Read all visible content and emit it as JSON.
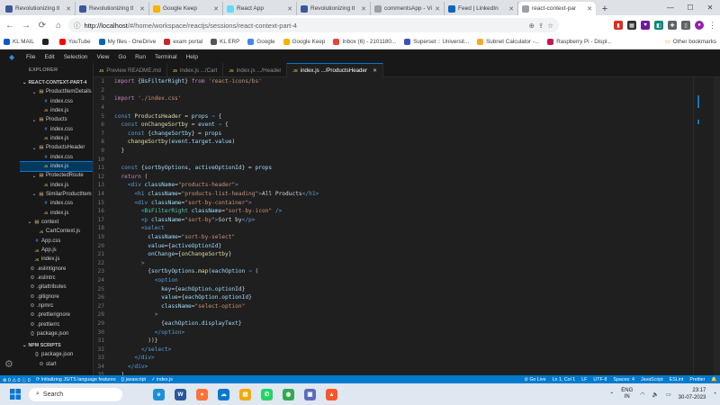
{
  "browser": {
    "tabs": [
      {
        "title": "Revolutionizing tl",
        "color": "#3b5998",
        "active": false
      },
      {
        "title": "Revolutionizing tl",
        "color": "#3b5998",
        "active": false
      },
      {
        "title": "Google Keep",
        "color": "#f4b400",
        "active": false
      },
      {
        "title": "React App",
        "color": "#61dafb",
        "active": false
      },
      {
        "title": "Revolutionizing tl",
        "color": "#3b5998",
        "active": false
      },
      {
        "title": "commentsApp - Vi",
        "color": "#9aa0a6",
        "active": false
      },
      {
        "title": "Feed | LinkedIn",
        "color": "#0a66c2",
        "active": false
      },
      {
        "title": "react-context-par",
        "color": "#9aa0a6",
        "active": true
      }
    ],
    "url_host": "http://localhost",
    "url_path": "/#/home/workspace/reactjs/sessions/react-context-part-4",
    "bookmarks": [
      {
        "label": "KL MAIL",
        "color": "#0b57d0"
      },
      {
        "label": "",
        "color": "#222222"
      },
      {
        "label": "YouTube",
        "color": "#ff0000"
      },
      {
        "label": "My files - OneDrive",
        "color": "#0364b8"
      },
      {
        "label": "exam portal",
        "color": "#c62828"
      },
      {
        "label": "KL ERP",
        "color": "#555555"
      },
      {
        "label": "Google",
        "color": "#4285f4"
      },
      {
        "label": "Google Keep",
        "color": "#f4b400"
      },
      {
        "label": "Inbox (6) - 2101180...",
        "color": "#ea4335"
      },
      {
        "label": "Superset :: Universit...",
        "color": "#3f51b5"
      },
      {
        "label": "Subnet Calculator -...",
        "color": "#f9a825"
      },
      {
        "label": "Raspberry Pi - Displ...",
        "color": "#c51a4a"
      }
    ],
    "other_bookmarks": "Other bookmarks"
  },
  "vscode": {
    "menu": [
      "File",
      "Edit",
      "Selection",
      "View",
      "Go",
      "Run",
      "Terminal",
      "Help"
    ],
    "explorer_title": "EXPLORER",
    "project_title": "REACT-CONTEXT-PART-4",
    "npm_scripts_title": "NPM SCRIPTS",
    "tree": [
      {
        "label": "ProductItemDetails",
        "type": "folder",
        "indent": 2,
        "open": true,
        "ghost": false
      },
      {
        "label": "index.css",
        "type": "css",
        "indent": 3
      },
      {
        "label": "index.js",
        "type": "js",
        "indent": 3
      },
      {
        "label": "Products",
        "type": "folder",
        "indent": 2,
        "open": true
      },
      {
        "label": "index.css",
        "type": "css",
        "indent": 3
      },
      {
        "label": "index.js",
        "type": "js",
        "indent": 3
      },
      {
        "label": "ProductsHeader",
        "type": "folder",
        "indent": 2,
        "open": true
      },
      {
        "label": "index.css",
        "type": "css",
        "indent": 3
      },
      {
        "label": "index.js",
        "type": "js",
        "indent": 3,
        "selected": true
      },
      {
        "label": "ProtectedRoute",
        "type": "folder",
        "indent": 2,
        "open": true
      },
      {
        "label": "index.js",
        "type": "js",
        "indent": 3
      },
      {
        "label": "SimilarProductItem",
        "type": "folder",
        "indent": 2,
        "open": true
      },
      {
        "label": "index.css",
        "type": "css",
        "indent": 3
      },
      {
        "label": "index.js",
        "type": "js",
        "indent": 3
      },
      {
        "label": "context",
        "type": "folder",
        "indent": 1,
        "open": true
      },
      {
        "label": "CartContext.js",
        "type": "js",
        "indent": 2
      },
      {
        "label": "App.css",
        "type": "css",
        "indent": 1
      },
      {
        "label": "App.js",
        "type": "js",
        "indent": 1
      },
      {
        "label": "index.js",
        "type": "js",
        "indent": 1
      },
      {
        "label": ".eslintignore",
        "type": "cfg",
        "indent": 0
      },
      {
        "label": ".eslintrc",
        "type": "cfg",
        "indent": 0
      },
      {
        "label": ".gitattributes",
        "type": "cfg",
        "indent": 0
      },
      {
        "label": ".gitignore",
        "type": "cfg",
        "indent": 0
      },
      {
        "label": ".npmrc",
        "type": "cfg",
        "indent": 0
      },
      {
        "label": ".prettierignore",
        "type": "cfg",
        "indent": 0
      },
      {
        "label": ".prettierrc",
        "type": "cfg",
        "indent": 0
      },
      {
        "label": "package.json",
        "type": "json",
        "indent": 0
      }
    ],
    "npm_tree": [
      {
        "label": "package.json",
        "type": "json",
        "indent": 1
      },
      {
        "label": "start",
        "type": "cfg",
        "indent": 2
      }
    ],
    "editor_tabs": [
      {
        "label": "Preview README.md",
        "active": false
      },
      {
        "label": "index.js .../Cart",
        "active": false
      },
      {
        "label": "index.js .../Header",
        "active": false
      },
      {
        "label": "index.js .../ProductsHeader",
        "active": true
      }
    ],
    "syntax_colors": {
      "keyword": "#c586c0",
      "decl": "#569cd6",
      "string": "#ce9178",
      "var": "#9cdcfe",
      "func": "#dcdcaa",
      "tag": "#569cd6",
      "attr": "#9cdcfe",
      "text": "#d4d4d4",
      "component": "#4ec9b0",
      "brace": "#ffd700"
    },
    "code_lines": [
      [
        [
          "keyword",
          "import "
        ],
        [
          "text",
          "{"
        ],
        [
          "var",
          "BsFilterRight"
        ],
        [
          "text",
          "} "
        ],
        [
          "keyword",
          "from "
        ],
        [
          "string",
          "'react-icons/bs'"
        ]
      ],
      [],
      [
        [
          "keyword",
          "import "
        ],
        [
          "string",
          "'./index.css'"
        ]
      ],
      [],
      [
        [
          "decl",
          "const "
        ],
        [
          "func",
          "ProductsHeader"
        ],
        [
          "text",
          " = "
        ],
        [
          "var",
          "props"
        ],
        [
          "decl",
          " ⇒ "
        ],
        [
          "text",
          "{"
        ]
      ],
      [
        [
          "text",
          "  "
        ],
        [
          "decl",
          "const "
        ],
        [
          "func",
          "onChangeSortby"
        ],
        [
          "text",
          " = "
        ],
        [
          "var",
          "event"
        ],
        [
          "decl",
          " ⇒ "
        ],
        [
          "text",
          "{"
        ]
      ],
      [
        [
          "text",
          "    "
        ],
        [
          "decl",
          "const "
        ],
        [
          "text",
          "{"
        ],
        [
          "var",
          "changeSortby"
        ],
        [
          "text",
          "} = "
        ],
        [
          "var",
          "props"
        ]
      ],
      [
        [
          "text",
          "    "
        ],
        [
          "func",
          "changeSortby"
        ],
        [
          "text",
          "("
        ],
        [
          "var",
          "event"
        ],
        [
          "text",
          "."
        ],
        [
          "var",
          "target"
        ],
        [
          "text",
          "."
        ],
        [
          "var",
          "value"
        ],
        [
          "text",
          ")"
        ]
      ],
      [
        [
          "text",
          "  }"
        ]
      ],
      [],
      [
        [
          "text",
          "  "
        ],
        [
          "decl",
          "const "
        ],
        [
          "text",
          "{"
        ],
        [
          "var",
          "sortbyOptions"
        ],
        [
          "text",
          ", "
        ],
        [
          "var",
          "activeOptionId"
        ],
        [
          "text",
          "} = "
        ],
        [
          "var",
          "props"
        ]
      ],
      [
        [
          "text",
          "  "
        ],
        [
          "keyword",
          "return "
        ],
        [
          "text",
          "("
        ]
      ],
      [
        [
          "text",
          "    "
        ],
        [
          "tag",
          "<div "
        ],
        [
          "attr",
          "className"
        ],
        [
          "text",
          "="
        ],
        [
          "string",
          "\"products-header\""
        ],
        [
          "tag",
          ">"
        ]
      ],
      [
        [
          "text",
          "      "
        ],
        [
          "tag",
          "<h1 "
        ],
        [
          "attr",
          "className"
        ],
        [
          "text",
          "="
        ],
        [
          "string",
          "\"products-list-heading\""
        ],
        [
          "tag",
          ">"
        ],
        [
          "text",
          "All Products"
        ],
        [
          "tag",
          "</h1>"
        ]
      ],
      [
        [
          "text",
          "      "
        ],
        [
          "tag",
          "<div "
        ],
        [
          "attr",
          "className"
        ],
        [
          "text",
          "="
        ],
        [
          "string",
          "\"sort-by-container\""
        ],
        [
          "tag",
          ">"
        ]
      ],
      [
        [
          "text",
          "        "
        ],
        [
          "tag",
          "<"
        ],
        [
          "component",
          "BsFilterRight "
        ],
        [
          "attr",
          "className"
        ],
        [
          "text",
          "="
        ],
        [
          "string",
          "\"sort-by-icon\""
        ],
        [
          "tag",
          " />"
        ]
      ],
      [
        [
          "text",
          "        "
        ],
        [
          "tag",
          "<p "
        ],
        [
          "attr",
          "className"
        ],
        [
          "text",
          "="
        ],
        [
          "string",
          "\"sort-by\""
        ],
        [
          "tag",
          ">"
        ],
        [
          "text",
          "Sort by"
        ],
        [
          "tag",
          "</p>"
        ]
      ],
      [
        [
          "text",
          "        "
        ],
        [
          "tag",
          "<select"
        ]
      ],
      [
        [
          "text",
          "          "
        ],
        [
          "attr",
          "className"
        ],
        [
          "text",
          "="
        ],
        [
          "string",
          "\"sort-by-select\""
        ]
      ],
      [
        [
          "text",
          "          "
        ],
        [
          "attr",
          "value"
        ],
        [
          "text",
          "={"
        ],
        [
          "var",
          "activeOptionId"
        ],
        [
          "text",
          "}"
        ]
      ],
      [
        [
          "text",
          "          "
        ],
        [
          "attr",
          "onChange"
        ],
        [
          "text",
          "={"
        ],
        [
          "func",
          "onChangeSortby"
        ],
        [
          "text",
          "}"
        ]
      ],
      [
        [
          "text",
          "        "
        ],
        [
          "tag",
          ">"
        ]
      ],
      [
        [
          "text",
          "          {"
        ],
        [
          "var",
          "sortbyOptions"
        ],
        [
          "text",
          "."
        ],
        [
          "func",
          "map"
        ],
        [
          "text",
          "("
        ],
        [
          "var",
          "eachOption"
        ],
        [
          "decl",
          " ⇒ "
        ],
        [
          "text",
          "("
        ]
      ],
      [
        [
          "text",
          "            "
        ],
        [
          "tag",
          "<option"
        ]
      ],
      [
        [
          "text",
          "              "
        ],
        [
          "attr",
          "key"
        ],
        [
          "text",
          "={"
        ],
        [
          "var",
          "eachOption"
        ],
        [
          "text",
          "."
        ],
        [
          "var",
          "optionId"
        ],
        [
          "text",
          "}"
        ]
      ],
      [
        [
          "text",
          "              "
        ],
        [
          "attr",
          "value"
        ],
        [
          "text",
          "={"
        ],
        [
          "var",
          "eachOption"
        ],
        [
          "text",
          "."
        ],
        [
          "var",
          "optionId"
        ],
        [
          "text",
          "}"
        ]
      ],
      [
        [
          "text",
          "              "
        ],
        [
          "attr",
          "className"
        ],
        [
          "text",
          "="
        ],
        [
          "string",
          "\"select-option\""
        ]
      ],
      [
        [
          "text",
          "            "
        ],
        [
          "tag",
          ">"
        ]
      ],
      [
        [
          "text",
          "              {"
        ],
        [
          "var",
          "eachOption"
        ],
        [
          "text",
          "."
        ],
        [
          "var",
          "displayText"
        ],
        [
          "text",
          "}"
        ]
      ],
      [
        [
          "text",
          "            "
        ],
        [
          "tag",
          "</option>"
        ]
      ],
      [
        [
          "text",
          "          ))}"
        ]
      ],
      [
        [
          "text",
          "        "
        ],
        [
          "tag",
          "</select>"
        ]
      ],
      [
        [
          "text",
          "      "
        ],
        [
          "tag",
          "</div>"
        ]
      ],
      [
        [
          "text",
          "    "
        ],
        [
          "tag",
          "</div>"
        ]
      ],
      [
        [
          "text",
          "  )"
        ]
      ],
      [
        [
          "text",
          "}"
        ]
      ],
      [],
      [
        [
          "keyword",
          "export default "
        ],
        [
          "func",
          "ProductsHeader"
        ]
      ]
    ],
    "status_left": [
      "⊗ 0 ⚠ 0 ⓘ 0",
      "⟳ Initializing JS/TS language features",
      "{} javascript",
      "✓ index.js"
    ],
    "status_right": [
      "⊘ Go Live",
      "Ln 1, Col 1",
      "LF",
      "UTF-8",
      "Spaces: 4",
      "JavaScript",
      "ESLint",
      "Prettier",
      "🔔"
    ]
  },
  "taskbar": {
    "search_placeholder": "Search",
    "apps": [
      {
        "name": "edge-icon",
        "color": "#1f8fd9",
        "glyph": "e"
      },
      {
        "name": "word-icon",
        "color": "#2b579a",
        "glyph": "W"
      },
      {
        "name": "firefox-icon",
        "color": "#ff7139",
        "glyph": "●"
      },
      {
        "name": "onedrive-icon",
        "color": "#0078d4",
        "glyph": "☁"
      },
      {
        "name": "files-icon",
        "color": "#f4a900",
        "glyph": "▤"
      },
      {
        "name": "whatsapp-icon",
        "color": "#25d366",
        "glyph": "✆"
      },
      {
        "name": "chrome-icon",
        "color": "#34a853",
        "glyph": "◉"
      },
      {
        "name": "photos-icon",
        "color": "#5c6bc0",
        "glyph": "▣"
      },
      {
        "name": "brave-icon",
        "color": "#fb542b",
        "glyph": "▲"
      }
    ],
    "lang_top": "ENG",
    "lang_bottom": "IN",
    "time": "23:17",
    "date": "30-07-2023"
  }
}
